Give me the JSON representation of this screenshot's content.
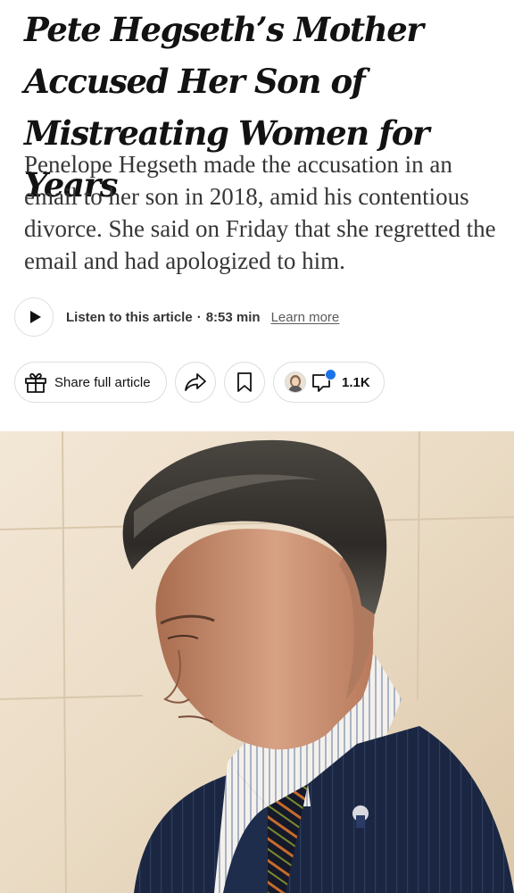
{
  "article": {
    "headline": "Pete Hegseth’s Mother Accused Her Son of Mistreating Women for Years",
    "summary": "Penelope Hegseth made the accusation in an email to her son in 2018, amid his contentious divorce. She said on Friday that she regretted the email and had apologized to him."
  },
  "audio": {
    "play_icon": "play-icon",
    "label": "Listen to this article",
    "separator": "·",
    "duration": "8:53 min",
    "learn_more": "Learn more"
  },
  "share_bar": {
    "share_label": "Share full article",
    "share_icon": "gift-icon",
    "forward_icon": "share-arrow-icon",
    "save_icon": "bookmark-icon",
    "comment_icon": "comment-bubble-icon",
    "comment_count": "1.1K",
    "notification_color": "#1a73e8"
  },
  "photo": {
    "subject": "man with slicked-back graying hair, navy pinstripe suit, striped shirt and striped tie, looking down in a beige stone hallway"
  }
}
